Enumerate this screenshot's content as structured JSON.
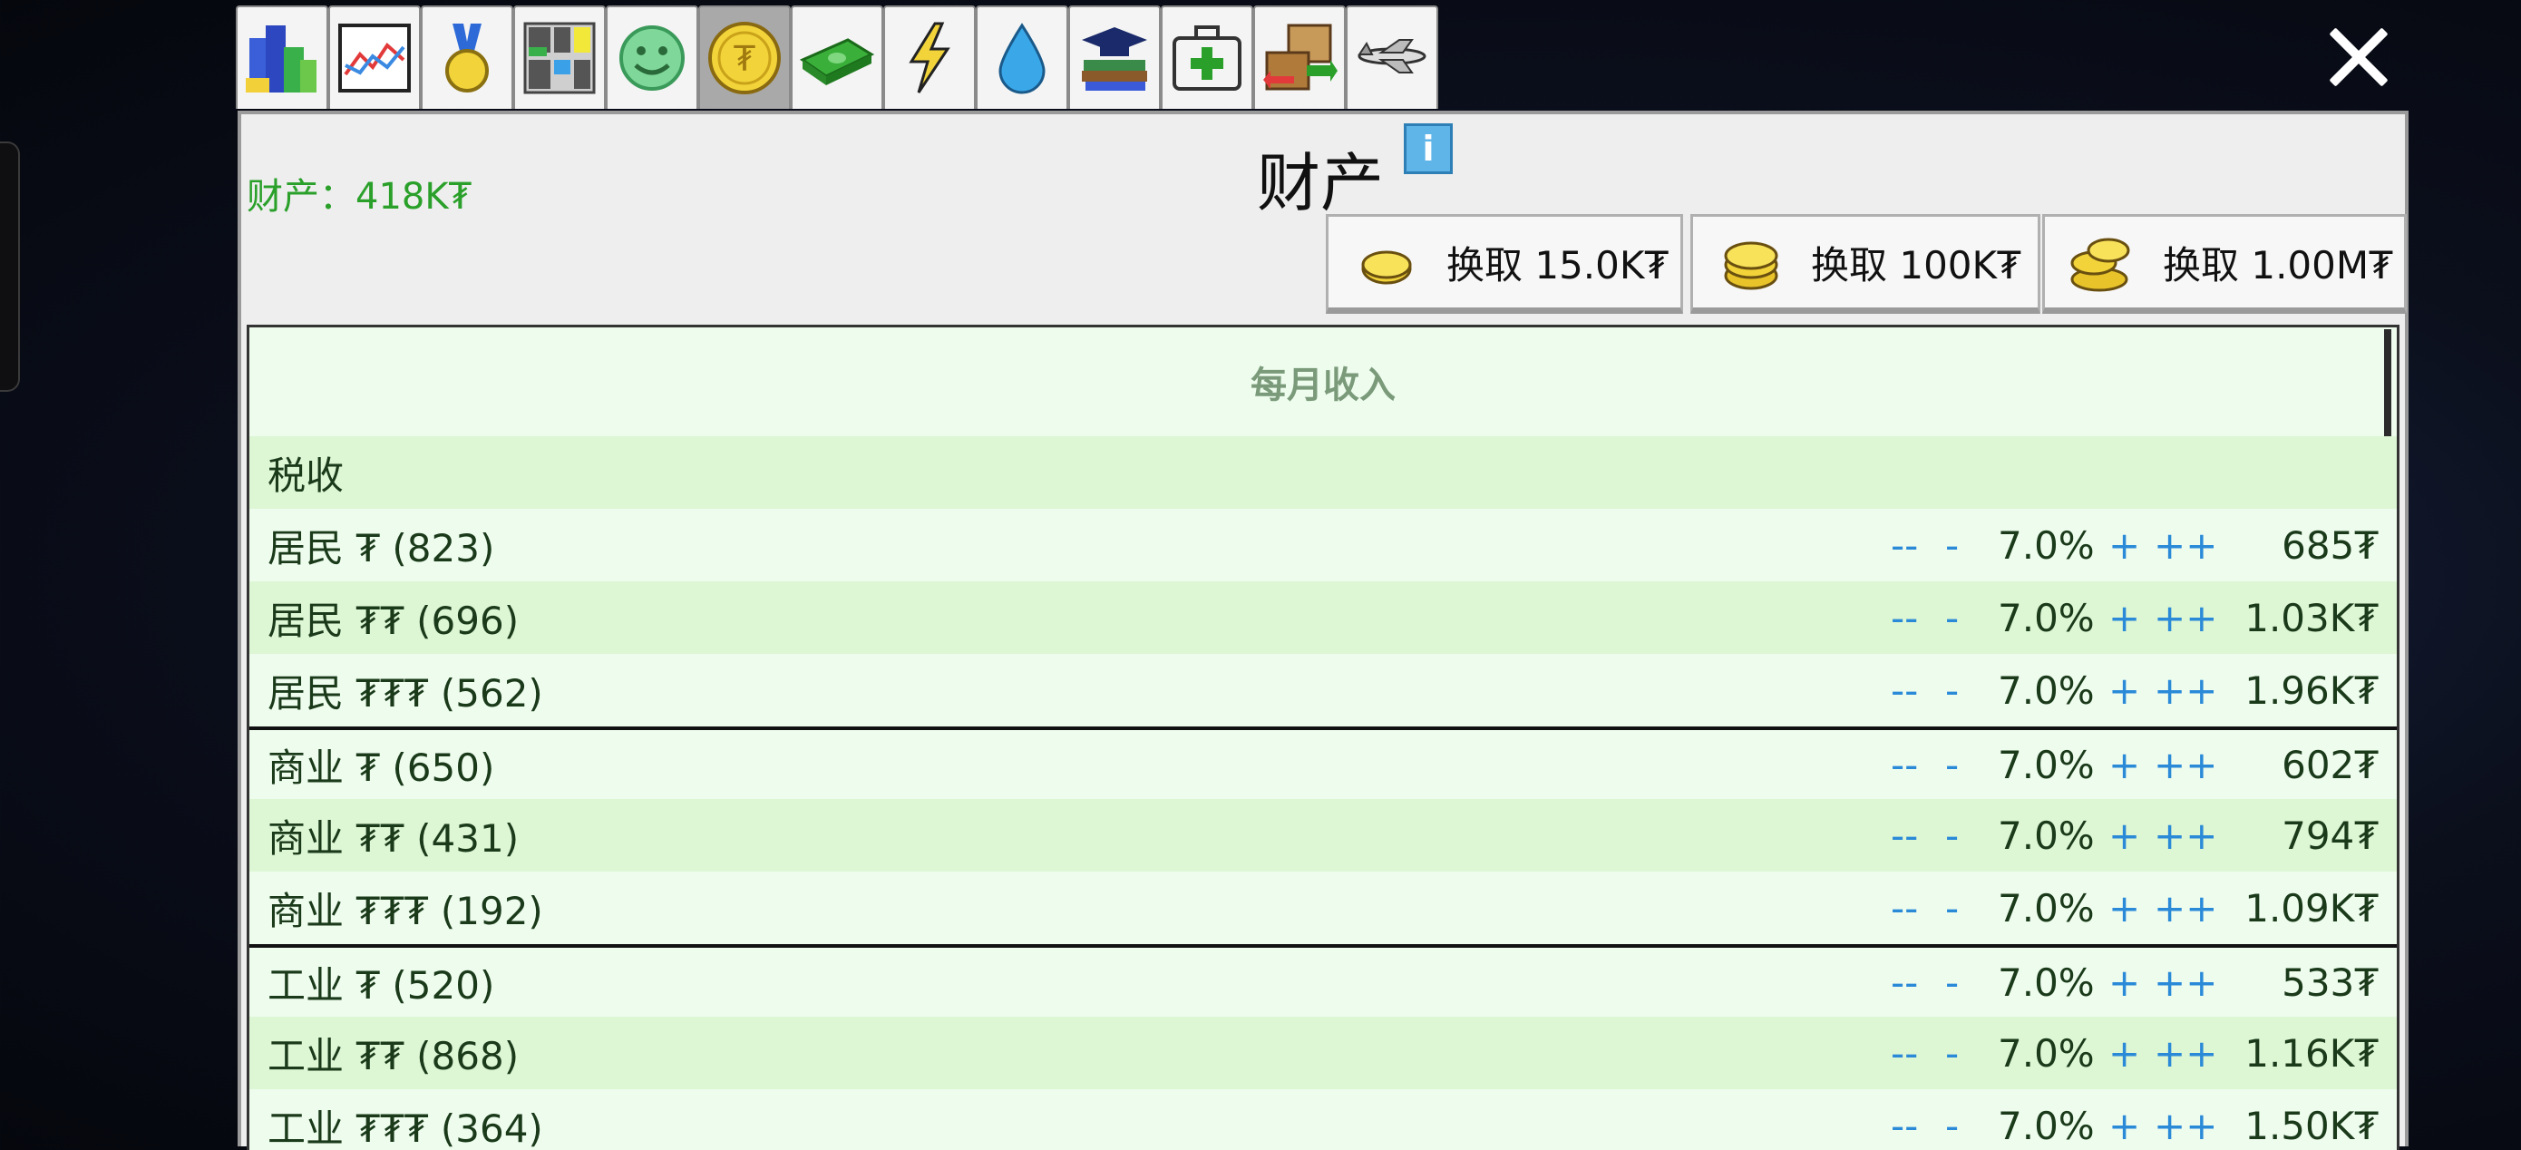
{
  "tabs": [
    {
      "name": "city",
      "icon": "city-buildings-icon"
    },
    {
      "name": "graph",
      "icon": "line-chart-icon"
    },
    {
      "name": "medal",
      "icon": "medal-icon"
    },
    {
      "name": "zones",
      "icon": "zones-map-icon"
    },
    {
      "name": "happiness",
      "icon": "smiley-face-icon"
    },
    {
      "name": "finance",
      "icon": "coin-icon",
      "active": true
    },
    {
      "name": "money",
      "icon": "banknote-icon"
    },
    {
      "name": "power",
      "icon": "lightning-icon"
    },
    {
      "name": "water",
      "icon": "water-drop-icon"
    },
    {
      "name": "education",
      "icon": "books-graduation-cap-icon"
    },
    {
      "name": "health",
      "icon": "medical-kit-icon"
    },
    {
      "name": "trade",
      "icon": "trade-boxes-icon"
    },
    {
      "name": "airport",
      "icon": "airplane-icon"
    }
  ],
  "assets_label": "财产：418K₮",
  "title": "财产",
  "info_label": "i",
  "exchange": [
    {
      "label": "换取 15.0K₮",
      "icon": "small-coin-icon"
    },
    {
      "label": "换取 100K₮",
      "icon": "coin-stack-icon"
    },
    {
      "label": "换取 1.00M₮",
      "icon": "large-coin-pile-icon"
    }
  ],
  "list_header": "每月收入",
  "section_label": "税收",
  "controls": {
    "dec_big": "--",
    "dec": "-",
    "inc": "+",
    "inc_big": "++"
  },
  "rows": [
    {
      "name": "居民 ₮ (823)",
      "rate": "7.0%",
      "value": "685₮"
    },
    {
      "name": "居民 ₮₮ (696)",
      "rate": "7.0%",
      "value": "1.03K₮"
    },
    {
      "name": "居民 ₮₮₮ (562)",
      "rate": "7.0%",
      "value": "1.96K₮"
    },
    {
      "name": "商业 ₮ (650)",
      "rate": "7.0%",
      "value": "602₮"
    },
    {
      "name": "商业 ₮₮ (431)",
      "rate": "7.0%",
      "value": "794₮"
    },
    {
      "name": "商业 ₮₮₮ (192)",
      "rate": "7.0%",
      "value": "1.09K₮"
    },
    {
      "name": "工业 ₮ (520)",
      "rate": "7.0%",
      "value": "533₮"
    },
    {
      "name": "工业 ₮₮ (868)",
      "rate": "7.0%",
      "value": "1.16K₮"
    },
    {
      "name": "工业 ₮₮₮ (364)",
      "rate": "7.0%",
      "value": "1.50K₮"
    }
  ],
  "colors": {
    "assets_green": "#2aa02a",
    "control_blue": "#2a8ad8",
    "list_bg": "#ecfbec",
    "row_alt": "#ddf6d4"
  }
}
